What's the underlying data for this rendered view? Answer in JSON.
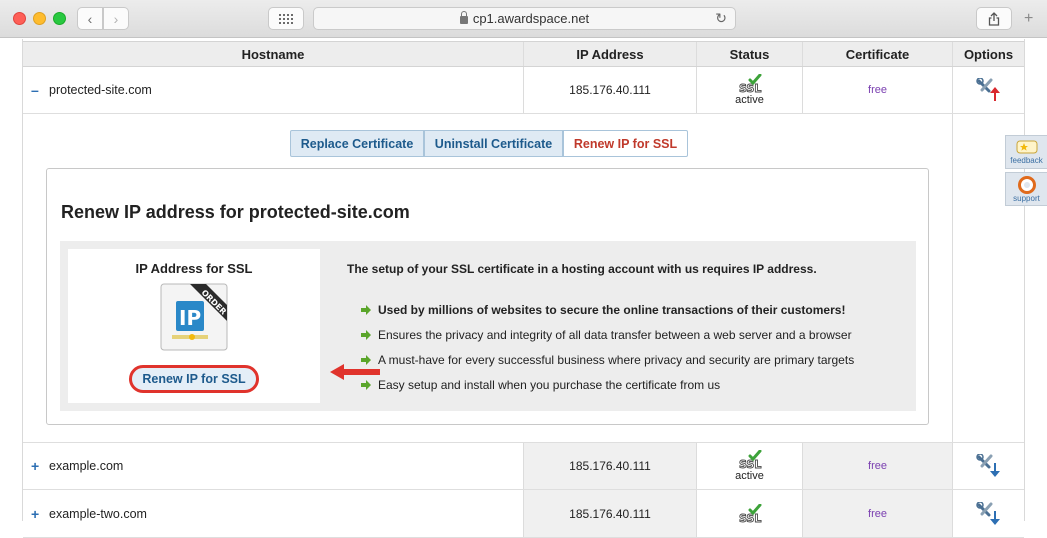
{
  "browser": {
    "url": "cp1.awardspace.net"
  },
  "table": {
    "headers": {
      "hostname": "Hostname",
      "ip": "IP Address",
      "status": "Status",
      "certificate": "Certificate",
      "options": "Options"
    },
    "rows": [
      {
        "toggle": "–",
        "hostname": "protected-site.com",
        "ip": "185.176.40.111",
        "status": "active",
        "certificate": "free"
      },
      {
        "toggle": "+",
        "hostname": "example.com",
        "ip": "185.176.40.111",
        "status": "active",
        "certificate": "free"
      },
      {
        "toggle": "+",
        "hostname": "example-two.com",
        "ip": "185.176.40.111",
        "status": "",
        "certificate": "free"
      }
    ]
  },
  "panel": {
    "tabs": {
      "replace": "Replace Certificate",
      "uninstall": "Uninstall Certificate",
      "renew": "Renew IP for SSL"
    },
    "title": "Renew IP address for protected-site.com",
    "card": {
      "title": "IP Address for SSL",
      "button": "Renew IP for SSL"
    },
    "intro": "The setup of your SSL certificate in a hosting account with us requires IP address.",
    "bullets": [
      "Used by millions of websites to secure the online transactions of their customers!",
      "Ensures the privacy and integrity of all data transfer between a web server and a browser",
      "A must-have for every successful business where privacy and security are primary targets",
      "Easy setup and install when you purchase the certificate from us"
    ]
  },
  "side": {
    "feedback": "feedback",
    "support": "support"
  },
  "icons": {
    "ssl": "ssl-check-icon",
    "tools_up": "tools-upload-icon",
    "tools_down": "tools-download-icon",
    "order": "ip-order-icon"
  },
  "colors": {
    "accent_red": "#e0332c",
    "link_blue": "#1d5a8c",
    "free_purple": "#7a3fb0",
    "bullet_green": "#5aa52a"
  }
}
